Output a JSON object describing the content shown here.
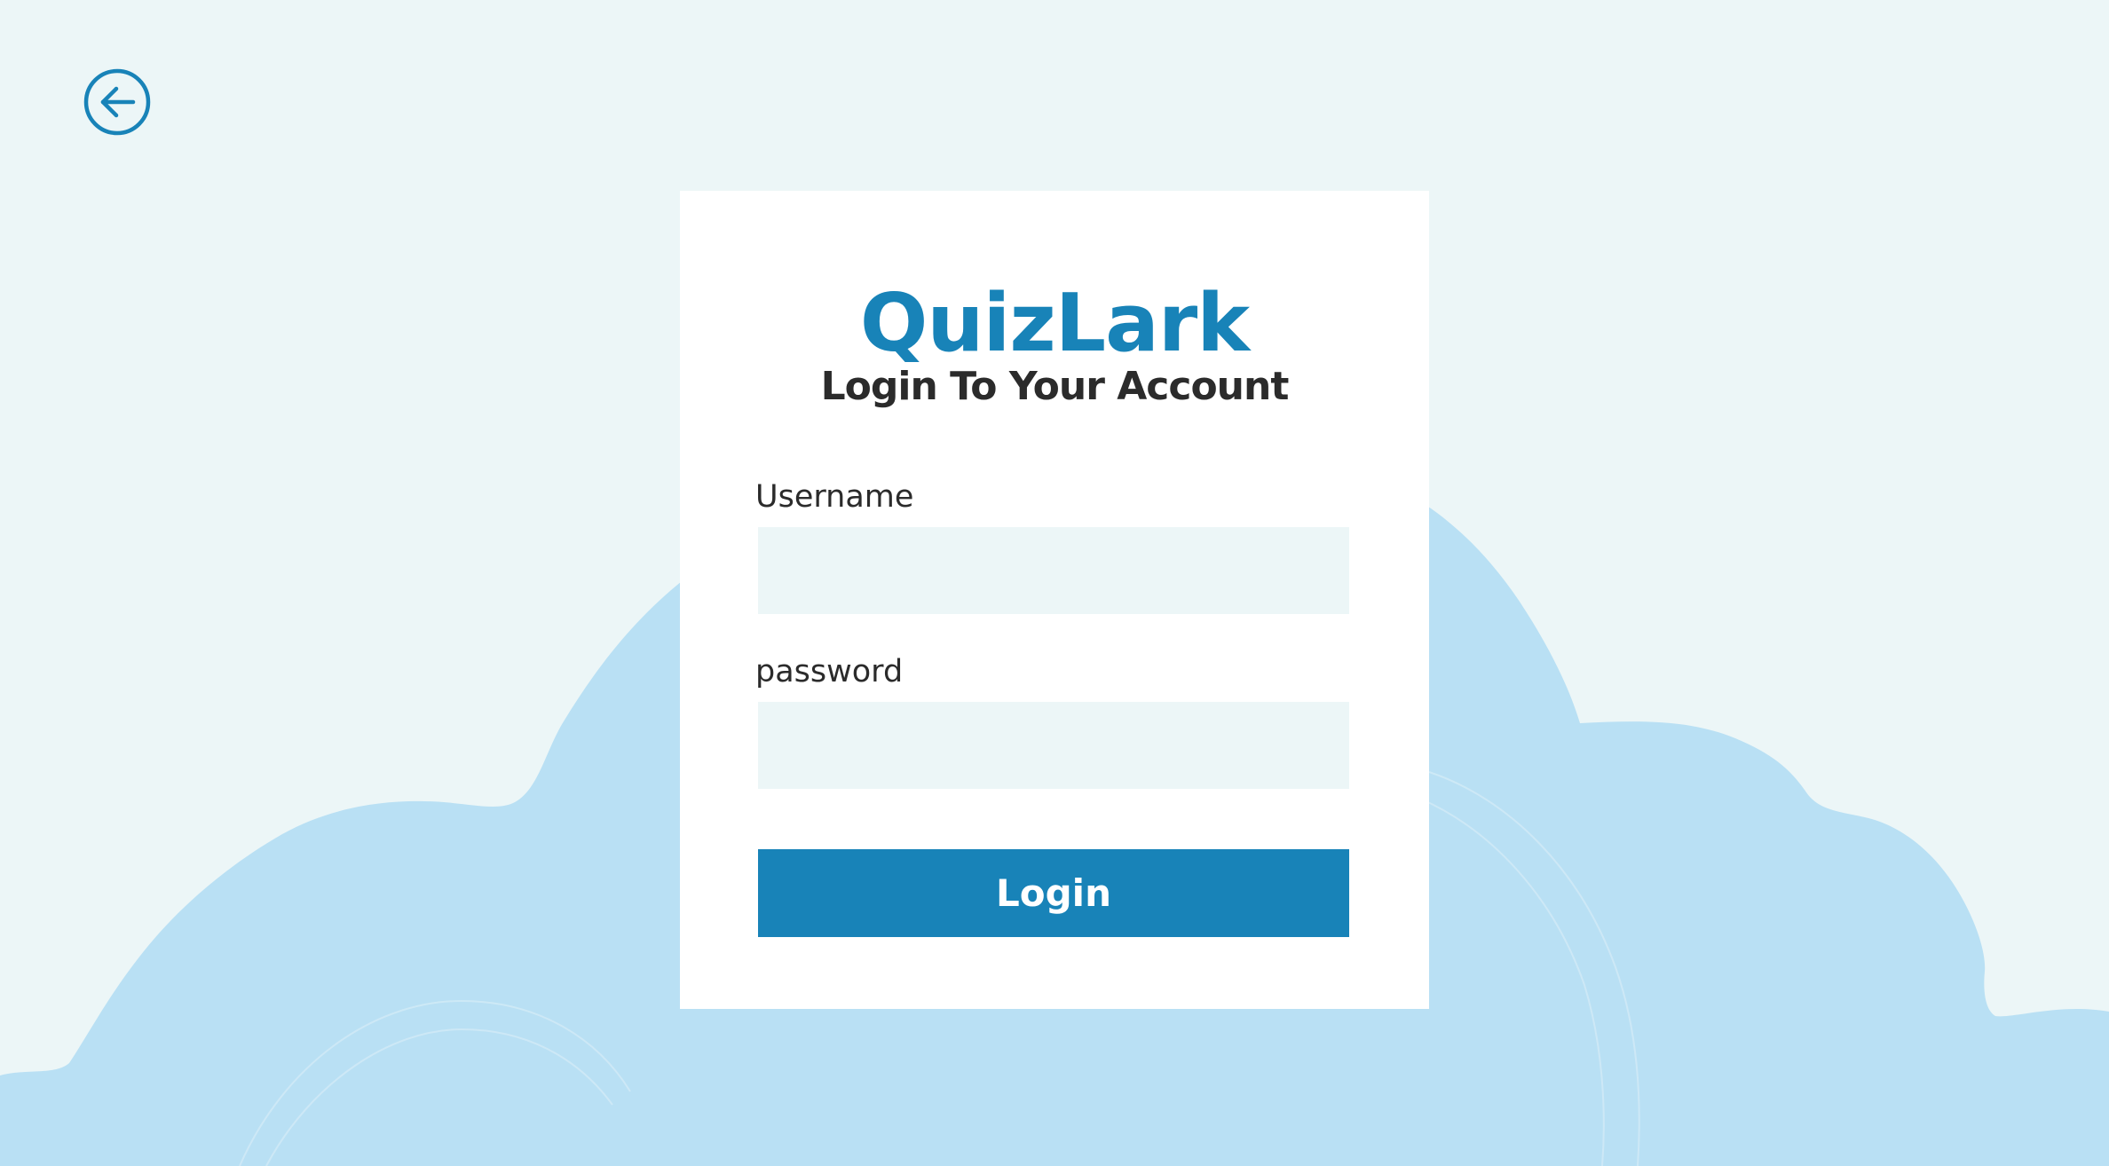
{
  "app": {
    "brand": "QuizLark",
    "subtitle": "Login To Your Account"
  },
  "nav": {
    "back_icon": "arrow-left-circle-icon"
  },
  "form": {
    "username": {
      "label": "Username",
      "value": "",
      "placeholder": ""
    },
    "password": {
      "label": "password",
      "value": "",
      "placeholder": ""
    },
    "submit_label": "Login"
  },
  "colors": {
    "background": "#ecf6f7",
    "cloud": "#b9e0f4",
    "card": "#ffffff",
    "accent": "#1883b8",
    "text": "#2b2b2b",
    "input_background": "#ecf6f7"
  }
}
